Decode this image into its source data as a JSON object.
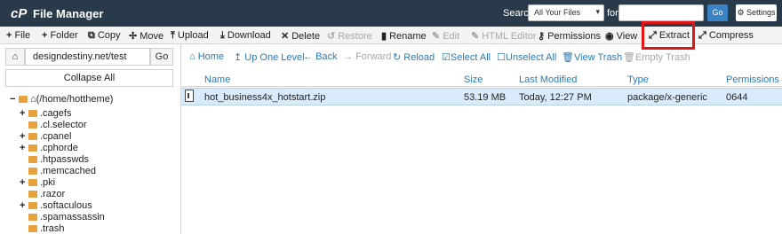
{
  "header": {
    "logo": "cP",
    "title": "File Manager",
    "search_label": "Search",
    "search_scope": "All Your Files",
    "for_label": "for",
    "search_value": "",
    "go_label": "Go",
    "settings_label": "Settings"
  },
  "toolbar": {
    "file": "File",
    "folder": "Folder",
    "copy": "Copy",
    "move": "Move",
    "upload": "Upload",
    "download": "Download",
    "delete": "Delete",
    "restore": "Restore",
    "rename": "Rename",
    "edit": "Edit",
    "html_editor": "HTML Editor",
    "permissions": "Permissions",
    "view": "View",
    "extract": "Extract",
    "compress": "Compress"
  },
  "left": {
    "path_value": "designdestiny.net/test",
    "go_label": "Go",
    "collapse_label": "Collapse All",
    "root_label": "(/home/hottheme)",
    "folders": [
      {
        "name": ".cagefs",
        "expandable": "+"
      },
      {
        "name": ".cl.selector",
        "expandable": ""
      },
      {
        "name": ".cpanel",
        "expandable": "+"
      },
      {
        "name": ".cphorde",
        "expandable": "+"
      },
      {
        "name": ".htpasswds",
        "expandable": ""
      },
      {
        "name": ".memcached",
        "expandable": ""
      },
      {
        "name": ".pki",
        "expandable": "+"
      },
      {
        "name": ".razor",
        "expandable": ""
      },
      {
        "name": ".softaculous",
        "expandable": "+"
      },
      {
        "name": ".spamassassin",
        "expandable": ""
      },
      {
        "name": ".trash",
        "expandable": ""
      }
    ]
  },
  "subbar": {
    "home": "Home",
    "up_one_level": "Up One Level",
    "back": "Back",
    "forward": "Forward",
    "reload": "Reload",
    "select_all": "Select All",
    "unselect_all": "Unselect All",
    "view_trash": "View Trash",
    "empty_trash": "Empty Trash"
  },
  "table": {
    "columns": [
      "Name",
      "Size",
      "Last Modified",
      "Type",
      "Permissions"
    ],
    "rows": [
      {
        "name": "hot_business4x_hotstart.zip",
        "size": "53.19 MB",
        "modified": "Today, 12:27 PM",
        "type": "package/x-generic",
        "permissions": "0644"
      }
    ]
  },
  "colors": {
    "header_bg": "#293a4a",
    "link": "#2a7ab8",
    "selected_row": "#d9ebfa",
    "highlight": "#e01616",
    "folder": "#e8a23d"
  }
}
